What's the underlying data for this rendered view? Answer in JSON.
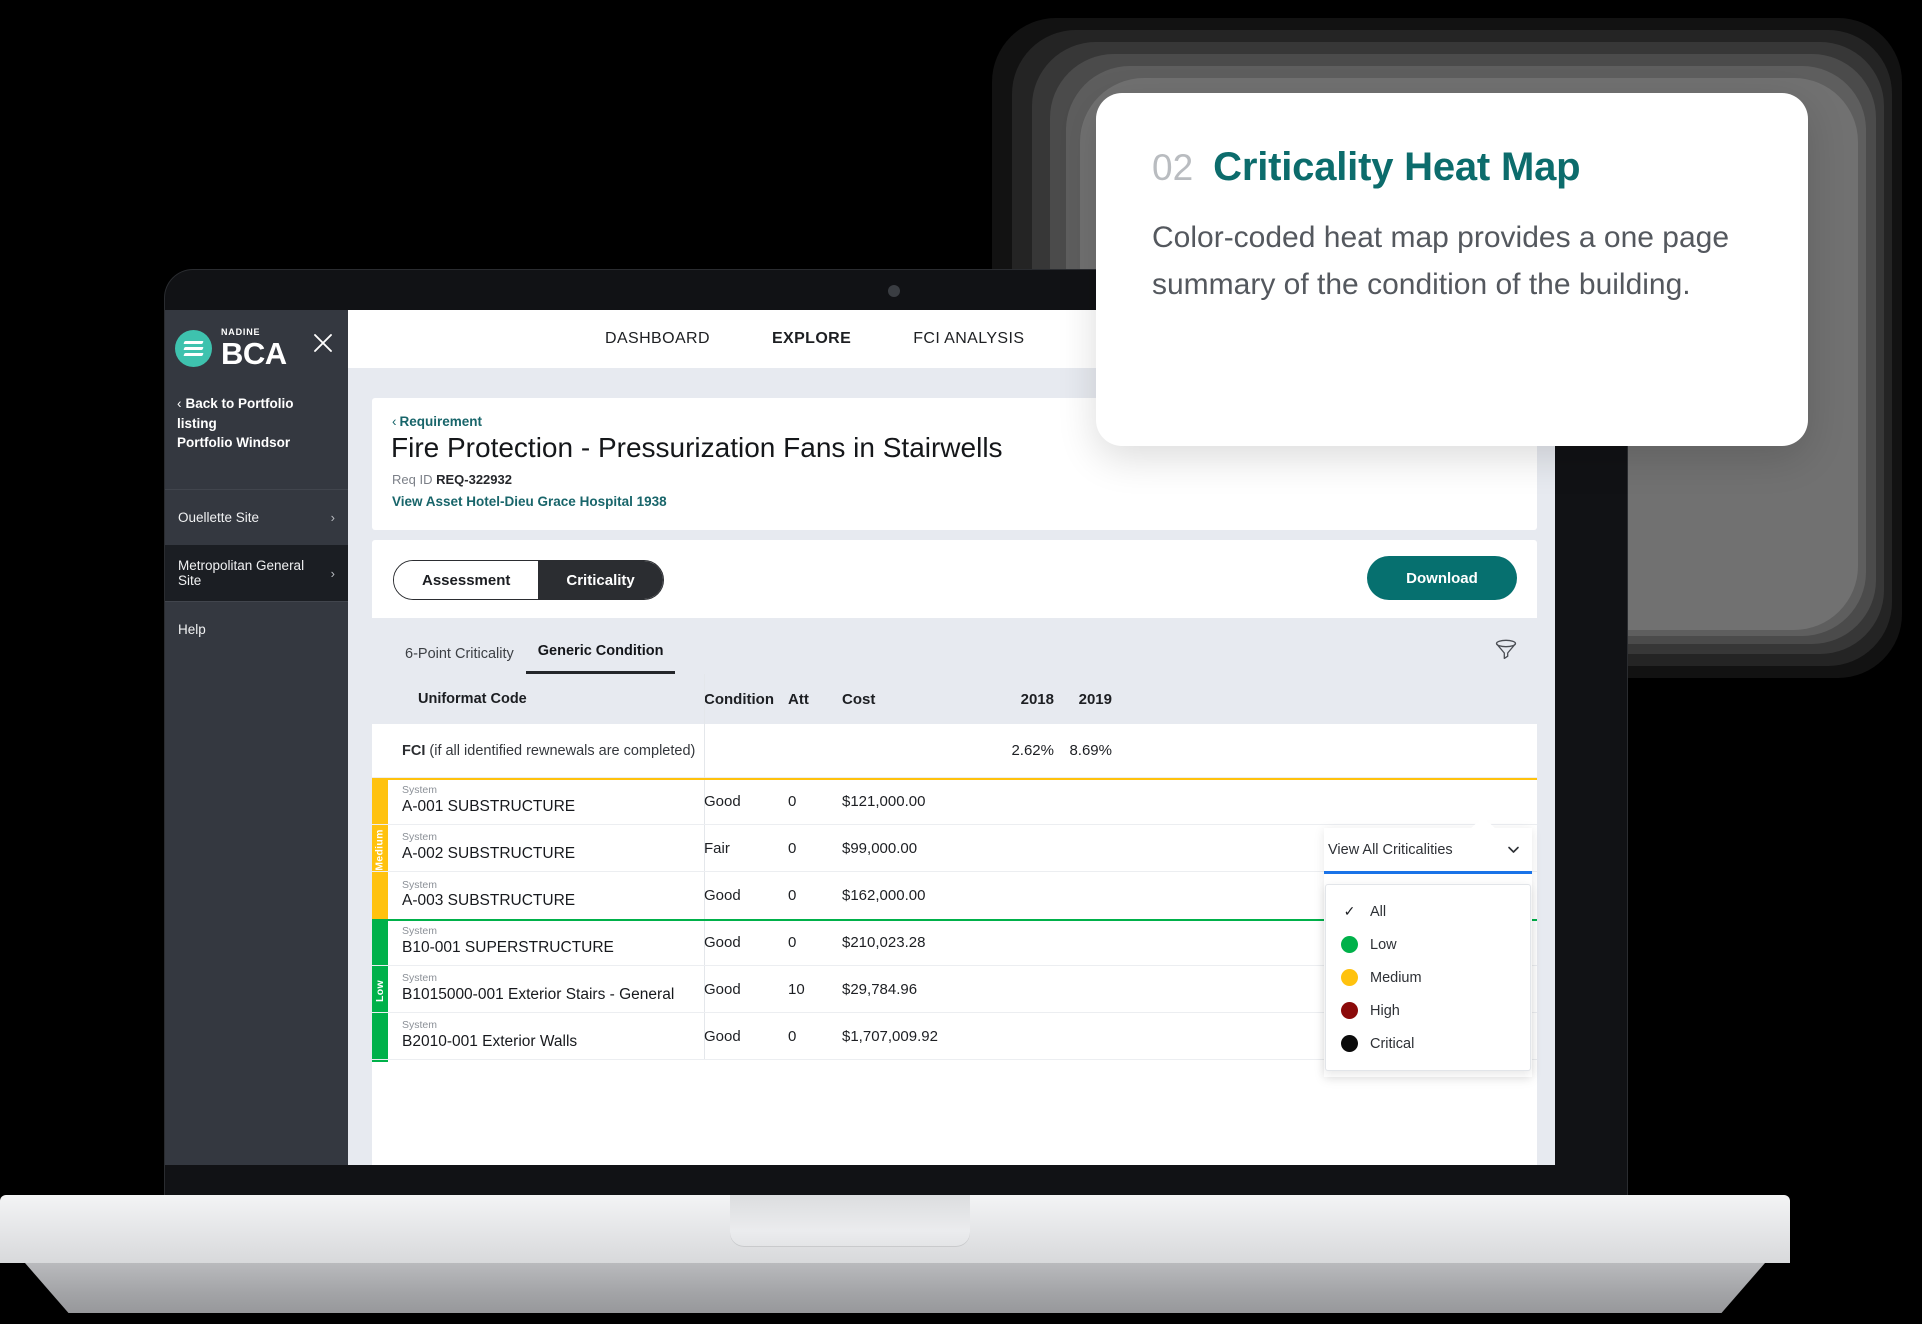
{
  "sidebar": {
    "logo_sup": "NADINE",
    "logo_main": "BCA",
    "close_icon": "close-icon",
    "back_chevron": "‹",
    "back_line1": "Back to Portfolio listing",
    "back_line2": "Portfolio Windsor",
    "items": [
      {
        "label": "Ouellette Site",
        "arrow": "›",
        "selected": false
      },
      {
        "label": "Metropolitan General Site",
        "arrow": "›",
        "selected": true
      },
      {
        "label": "Help",
        "arrow": "",
        "selected": false
      }
    ]
  },
  "topnav": {
    "items": [
      {
        "label": "DASHBOARD",
        "active": false
      },
      {
        "label": "EXPLORE",
        "active": true
      },
      {
        "label": "FCI ANALYSIS",
        "active": false
      }
    ]
  },
  "requirement": {
    "breadcrumb_chevron": "‹",
    "breadcrumb": "Requirement",
    "title": "Fire Protection - Pressurization Fans in Stairwells",
    "req_id_label": "Req ID",
    "req_id_value": "REQ-322932",
    "asset_link": "View Asset Hotel-Dieu Grace Hospital 1938"
  },
  "toggle": {
    "assessment": "Assessment",
    "criticality": "Criticality",
    "active": "Criticality"
  },
  "download_label": "Download",
  "subtabs": [
    {
      "label": "6-Point Criticality",
      "active": false
    },
    {
      "label": "Generic Condition",
      "active": true
    }
  ],
  "filter": {
    "funnel_icon": "filter-funnel-icon",
    "select_value": "View All Criticalities",
    "chevron_icon": "chevron-down-icon",
    "options": [
      {
        "label": "All",
        "marker": "check",
        "color": ""
      },
      {
        "label": "Low",
        "marker": "dot",
        "color": "#00b14a"
      },
      {
        "label": "Medium",
        "marker": "dot",
        "color": "#ffc20e"
      },
      {
        "label": "High",
        "marker": "dot",
        "color": "#8b0a0a"
      },
      {
        "label": "Critical",
        "marker": "dot",
        "color": "#0b0b0b"
      }
    ]
  },
  "table": {
    "columns": [
      "Uniformat Code",
      "Condition",
      "Att",
      "Cost",
      "2018",
      "2019"
    ],
    "fci_row": {
      "label_bold": "FCI",
      "label_rest": " (if all identified rewnewals are completed)",
      "y2018": "2.62%",
      "y2019": "8.69%"
    },
    "groups": [
      {
        "criticality": "Medium",
        "color": "#ffc20e",
        "rows": [
          {
            "kicker": "System",
            "name": "A-001 SUBSTRUCTURE",
            "condition": "Good",
            "att": "0",
            "cost": "$121,000.00"
          },
          {
            "kicker": "System",
            "name": "A-002 SUBSTRUCTURE",
            "condition": "Fair",
            "att": "0",
            "cost": "$99,000.00"
          },
          {
            "kicker": "System",
            "name": "A-003 SUBSTRUCTURE",
            "condition": "Good",
            "att": "0",
            "cost": "$162,000.00"
          }
        ]
      },
      {
        "criticality": "Low",
        "color": "#00b14a",
        "rows": [
          {
            "kicker": "System",
            "name": "B10-001 SUPERSTRUCTURE",
            "condition": "Good",
            "att": "0",
            "cost": "$210,023.28"
          },
          {
            "kicker": "System",
            "name": "B1015000-001 Exterior Stairs - General",
            "condition": "Good",
            "att": "10",
            "cost": "$29,784.96"
          },
          {
            "kicker": "System",
            "name": "B2010-001 Exterior Walls",
            "condition": "Good",
            "att": "0",
            "cost": "$1,707,009.92"
          }
        ]
      }
    ]
  },
  "callout": {
    "number": "02",
    "title": "Criticality Heat Map",
    "body": "Color-coded heat map provides a one page summary of the condition of the building."
  },
  "colors": {
    "brand_teal": "#06706f",
    "callout_teal": "#0c6c6c",
    "sidebar_bg": "#343840",
    "logo_green": "#3ec2ae",
    "content_bg": "#e7eaf0",
    "underline_blue": "#1a73e8"
  }
}
